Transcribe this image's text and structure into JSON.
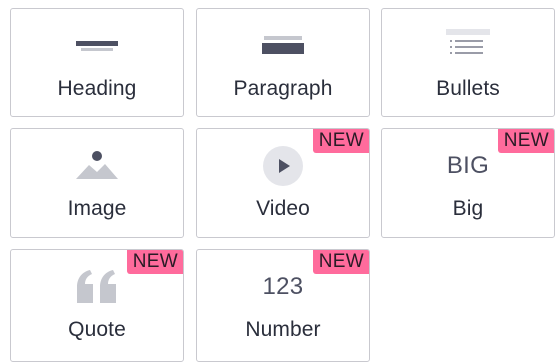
{
  "blocks": [
    {
      "label": "Heading",
      "icon": "heading-icon"
    },
    {
      "label": "Paragraph",
      "icon": "paragraph-icon"
    },
    {
      "label": "Bullets",
      "icon": "bullets-icon"
    },
    {
      "label": "Image",
      "icon": "image-icon"
    },
    {
      "label": "Video",
      "icon": "play-icon",
      "badge": "NEW"
    },
    {
      "label": "Big",
      "icon": "big-text-icon",
      "icon_text": "BIG",
      "badge": "NEW"
    },
    {
      "label": "Quote",
      "icon": "quote-icon",
      "badge": "NEW"
    },
    {
      "label": "Number",
      "icon": "number-icon",
      "icon_text": "123",
      "badge": "NEW"
    }
  ],
  "colors": {
    "badge": "#ff6b9c",
    "icon_dark": "#4d5062",
    "icon_light": "#c5c7ce",
    "text": "#2a2e3b",
    "border": "#c9c9cf"
  }
}
